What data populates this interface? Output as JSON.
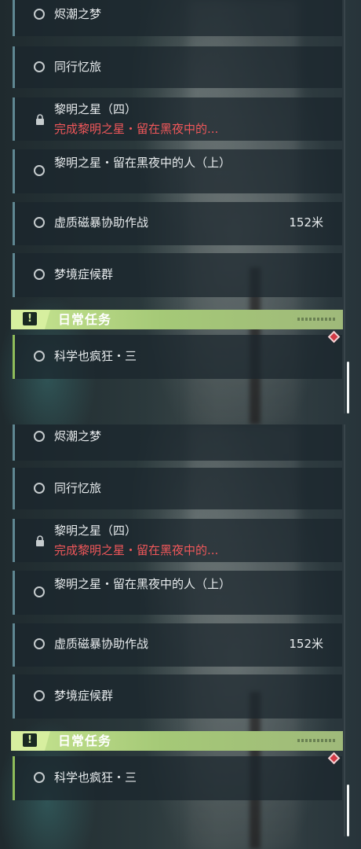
{
  "quests": [
    {
      "title": "烬潮之梦"
    },
    {
      "title": "同行忆旅"
    },
    {
      "title": "黎明之星（四）",
      "subtitle": "完成黎明之星・留在黑夜中的...",
      "locked": true
    },
    {
      "title": "黎明之星・留在黑夜中的人（上）"
    },
    {
      "title": "虚质磁暴协助作战",
      "distance": "152米"
    },
    {
      "title": "梦境症候群"
    }
  ],
  "daily_section": {
    "header": "日常任务",
    "badge_icon": "!",
    "items": [
      {
        "title": "科学也疯狂・三"
      }
    ]
  },
  "colors": {
    "accent_blue": "#5f8792",
    "accent_green": "#a5c977",
    "warning_red": "#f0575a",
    "marker_red": "#d23a46"
  }
}
